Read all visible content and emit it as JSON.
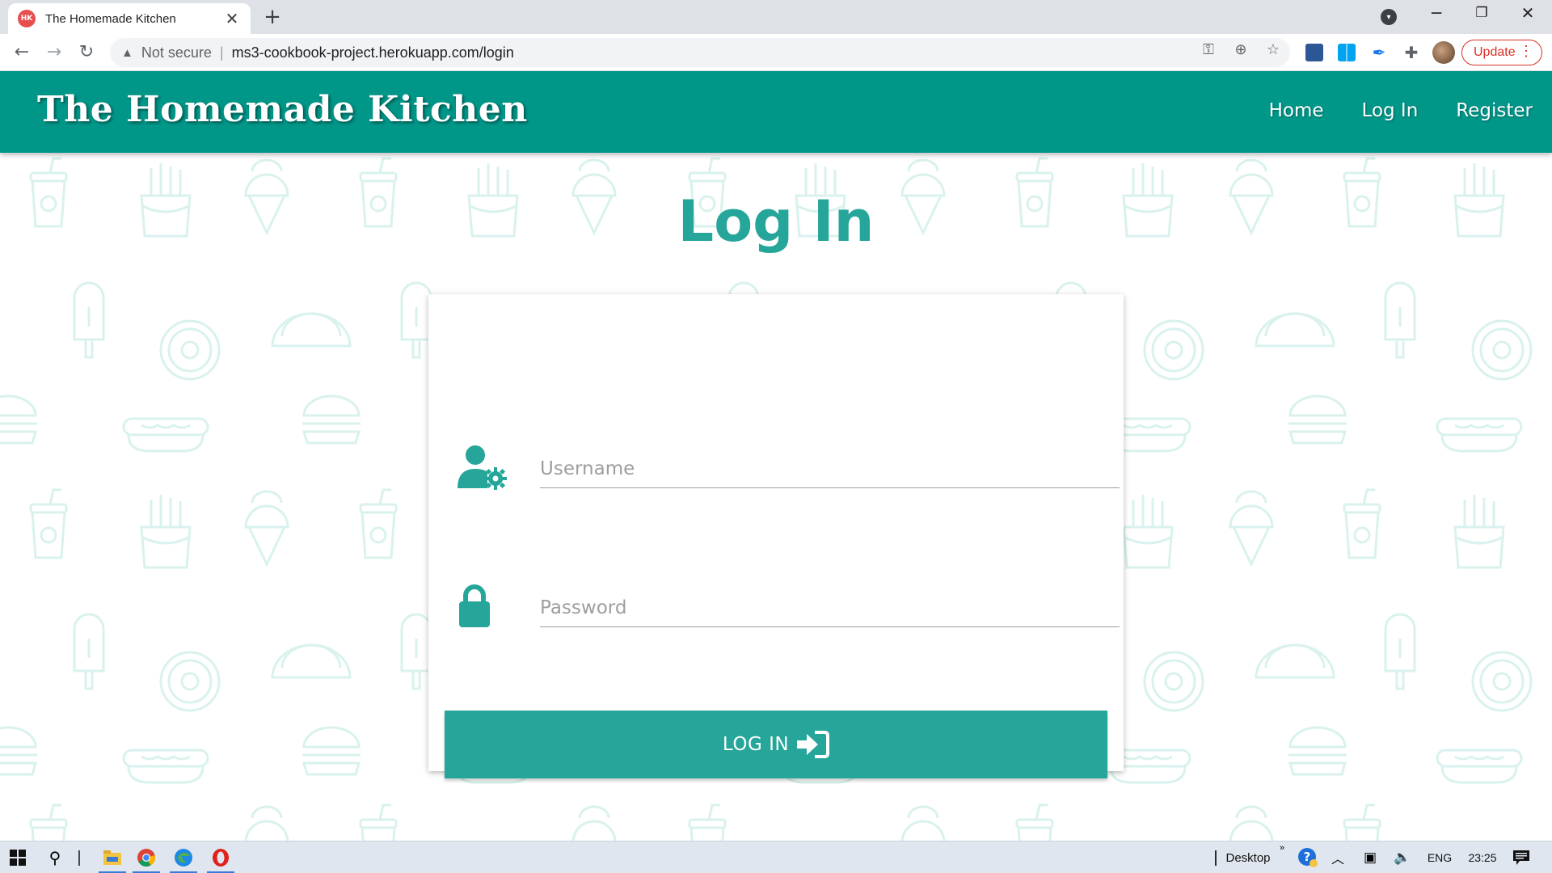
{
  "browser": {
    "tab_title": "The Homemade Kitchen",
    "tab_favicon_text": "HK",
    "new_tab_label": "+",
    "close_tab_label": "✕",
    "security_text": "Not secure",
    "url": "ms3-cookbook-project.herokuapp.com/login",
    "update_label": "Update"
  },
  "site": {
    "brand": "The Homemade Kitchen",
    "nav": [
      {
        "label": "Home"
      },
      {
        "label": "Log In"
      },
      {
        "label": "Register"
      }
    ]
  },
  "main": {
    "title": "Log In",
    "username_placeholder": "Username",
    "password_placeholder": "Password",
    "submit_label": "LOG IN"
  },
  "taskbar": {
    "desktop_label": "Desktop",
    "chevron_label": "»",
    "language": "ENG",
    "time": "23:25"
  },
  "colors": {
    "primary": "#009688",
    "accent": "#26a69a",
    "pattern": "#d9f2ee"
  },
  "icons": {
    "username": "user-cog-icon",
    "password": "lock-icon",
    "submit": "sign-in-icon"
  }
}
